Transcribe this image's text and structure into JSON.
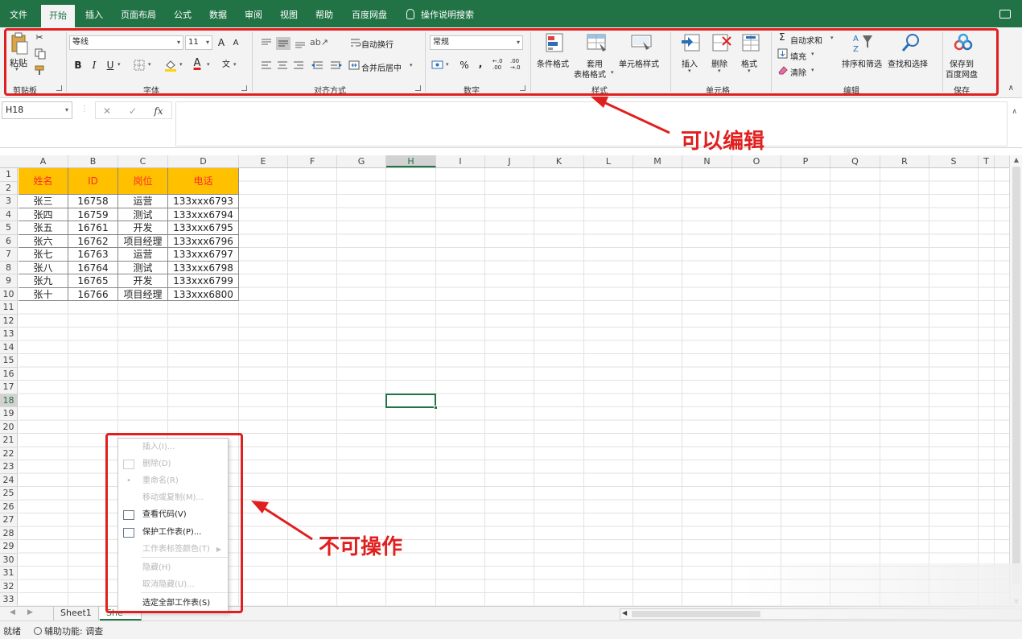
{
  "menu": {
    "tabs": [
      "文件",
      "开始",
      "插入",
      "页面布局",
      "公式",
      "数据",
      "审阅",
      "视图",
      "帮助",
      "百度网盘"
    ],
    "active": "开始",
    "search": "操作说明搜索"
  },
  "ribbon": {
    "clipboard": {
      "paste": "粘贴",
      "group": "剪贴板"
    },
    "font": {
      "name": "等线",
      "size": "11",
      "bold": "B",
      "italic": "I",
      "underline": "U",
      "grow": "A",
      "shrink": "A",
      "fontcolor": "A",
      "phonetic": "文",
      "group": "字体"
    },
    "alignment": {
      "wrap": "自动换行",
      "merge": "合并后居中",
      "group": "对齐方式"
    },
    "number": {
      "format": "常规",
      "percent": "%",
      "comma": ",",
      "inc": "←.0 .00",
      "dec": ".00 →.0",
      "group": "数字"
    },
    "styles": {
      "conditional": "条件格式",
      "table1": "套用",
      "table2": "表格格式",
      "cell": "单元格样式",
      "group": "样式"
    },
    "cells": {
      "insert": "插入",
      "delete": "删除",
      "format": "格式",
      "group": "单元格"
    },
    "editing": {
      "autosum": "自动求和",
      "fill": "填充",
      "clear": "清除",
      "sort": "排序和筛选",
      "find": "查找和选择",
      "group": "编辑"
    },
    "save": {
      "line1": "保存到",
      "line2": "百度网盘",
      "group": "保存"
    }
  },
  "formula": {
    "namebox": "H18",
    "cancel": "✕",
    "enter": "✓",
    "fx": "fx",
    "value": ""
  },
  "columns": [
    "A",
    "B",
    "C",
    "D",
    "E",
    "F",
    "G",
    "H",
    "I",
    "J",
    "K",
    "L",
    "M",
    "N",
    "O",
    "P",
    "Q",
    "R",
    "S",
    "T"
  ],
  "rows": [
    "1",
    "2",
    "3",
    "4",
    "5",
    "6",
    "7",
    "8",
    "9",
    "10",
    "11",
    "12",
    "13",
    "14",
    "15",
    "16",
    "17",
    "18",
    "19",
    "20",
    "21",
    "22",
    "23",
    "24",
    "25",
    "26",
    "27",
    "28",
    "29",
    "30",
    "31",
    "32",
    "33"
  ],
  "table": {
    "headers": [
      "姓名",
      "ID",
      "岗位",
      "电话"
    ],
    "rows": [
      [
        "张三",
        "16758",
        "运营",
        "133xxx6793"
      ],
      [
        "张四",
        "16759",
        "测试",
        "133xxx6794"
      ],
      [
        "张五",
        "16761",
        "开发",
        "133xxx6795"
      ],
      [
        "张六",
        "16762",
        "项目经理",
        "133xxx6796"
      ],
      [
        "张七",
        "16763",
        "运营",
        "133xxx6797"
      ],
      [
        "张八",
        "16764",
        "测试",
        "133xxx6798"
      ],
      [
        "张九",
        "16765",
        "开发",
        "133xxx6799"
      ],
      [
        "张十",
        "16766",
        "项目经理",
        "133xxx6800"
      ]
    ]
  },
  "context_menu": {
    "items": [
      {
        "label": "插入(I)...",
        "enabled": false
      },
      {
        "label": "删除(D)",
        "enabled": false
      },
      {
        "label": "重命名(R)",
        "enabled": false
      },
      {
        "label": "移动或复制(M)...",
        "enabled": false
      },
      {
        "label": "查看代码(V)",
        "enabled": true
      },
      {
        "label": "保护工作表(P)...",
        "enabled": true
      },
      {
        "label": "工作表标签颜色(T)",
        "enabled": false
      },
      {
        "label": "隐藏(H)",
        "enabled": false
      },
      {
        "label": "取消隐藏(U)...",
        "enabled": false
      },
      {
        "label": "选定全部工作表(S)",
        "enabled": true
      }
    ]
  },
  "sheets": {
    "tab1": "Sheet1",
    "tab2": "She"
  },
  "status": {
    "ready": "就绪",
    "accessibility": "辅助功能: 调查"
  },
  "annotations": {
    "editable": "可以编辑",
    "not_operable": "不可操作"
  },
  "colors": {
    "excel_green": "#217346",
    "header_fill": "#ffc000",
    "header_text": "#ff2a2a",
    "annotation_red": "#e02020"
  }
}
